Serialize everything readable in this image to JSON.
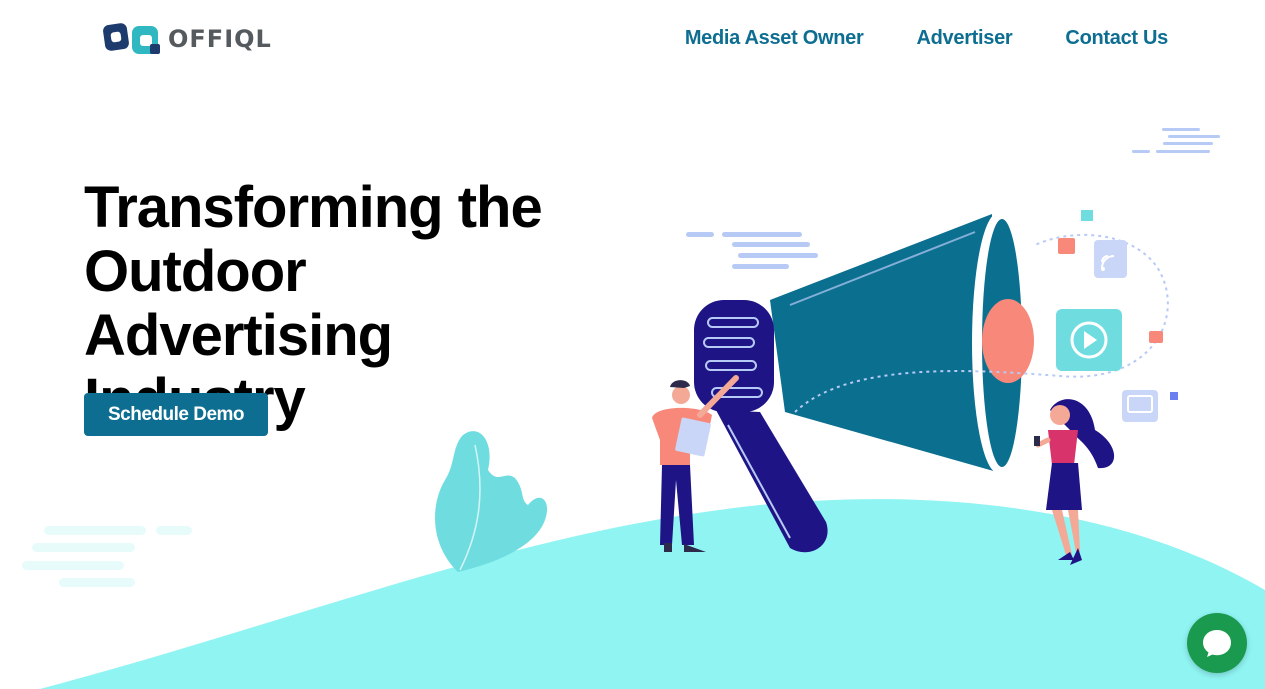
{
  "brand": {
    "name": "OFFIQL",
    "icon": "offiql-logo"
  },
  "nav": {
    "items": [
      {
        "label": "Media Asset Owner"
      },
      {
        "label": "Advertiser"
      },
      {
        "label": "Contact Us"
      }
    ]
  },
  "hero": {
    "title_lines": [
      "Transforming the",
      "Outdoor Advertising",
      "Industry"
    ],
    "cta_label": "Schedule Demo"
  },
  "chat": {
    "icon": "chat-bubble-icon"
  },
  "colors": {
    "brand_blue": "#0d6e91",
    "hill": "#8ff4f2",
    "megaphone_dark": "#1e1486",
    "chat_green": "#1a9a4f"
  }
}
